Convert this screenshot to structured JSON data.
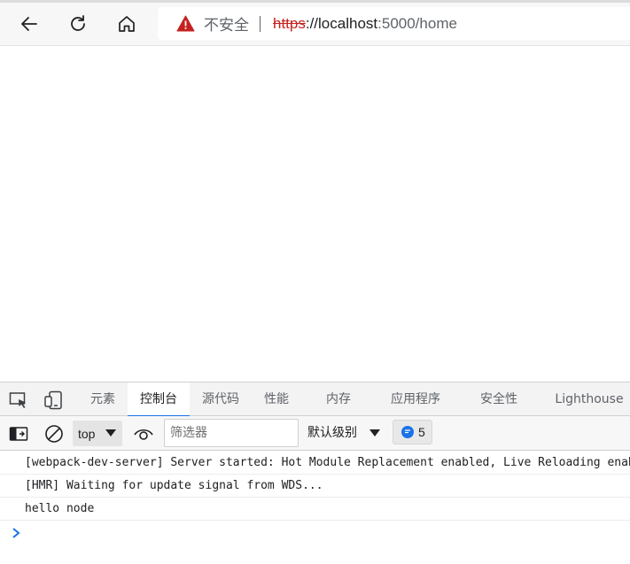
{
  "browser": {
    "back_icon": "arrow-left-icon",
    "reload_icon": "reload-icon",
    "home_icon": "home-icon",
    "security_icon": "warning-triangle-icon",
    "security_text": "不安全",
    "url_scheme": "https",
    "url_sep": "://",
    "url_host": "localhost",
    "url_rest": ":5000/home",
    "warning_color": "#c5221f"
  },
  "devtools": {
    "tabs": [
      {
        "label": "元素"
      },
      {
        "label": "控制台",
        "active": true
      },
      {
        "label": "源代码"
      },
      {
        "label": "性能"
      },
      {
        "label": "内存"
      },
      {
        "label": "应用程序"
      },
      {
        "label": "安全性"
      },
      {
        "label": "Lighthouse"
      }
    ],
    "toolbar": {
      "context_value": "top",
      "filter_placeholder": "筛选器",
      "levels_label": "默认级别",
      "issues_count": "5"
    },
    "console_lines": [
      "[webpack-dev-server] Server started: Hot Module Replacement enabled, Live Reloading enabled, Progress disabled, Overlay enabled.",
      "[HMR] Waiting for update signal from WDS...",
      "hello node"
    ],
    "accent_color": "#1a73e8"
  }
}
